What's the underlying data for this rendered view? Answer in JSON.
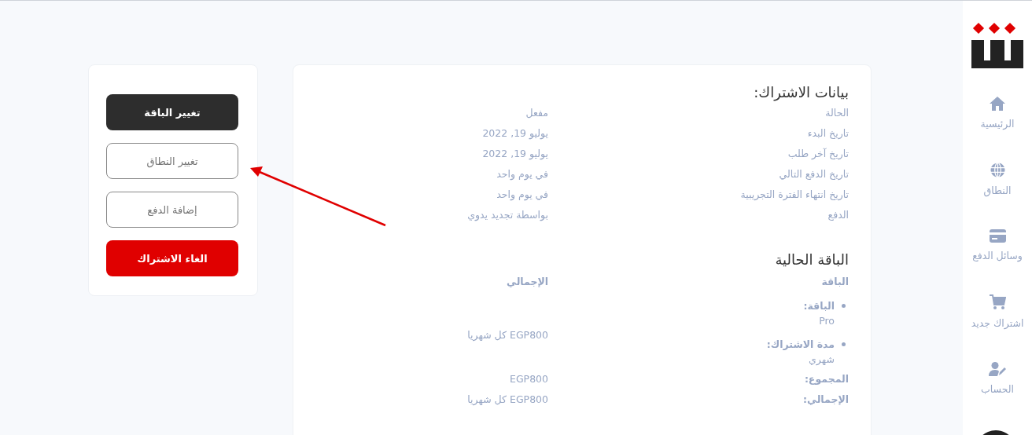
{
  "sidebar": {
    "items": [
      {
        "kind": "home",
        "label": "الرئيسية"
      },
      {
        "kind": "globe",
        "label": "النطاق"
      },
      {
        "kind": "card",
        "label": "وسائل الدفع"
      },
      {
        "kind": "cart",
        "label": "اشتراك جديد"
      },
      {
        "kind": "account",
        "label": "الحساب"
      }
    ]
  },
  "subscription_details": {
    "title": "بيانات الاشتراك:",
    "rows": [
      {
        "label": "الحالة",
        "value": "مفعل"
      },
      {
        "label": "تاريخ البدء",
        "value": "يوليو 19, 2022"
      },
      {
        "label": "تاريخ آخر طلب",
        "value": "يوليو 19, 2022"
      },
      {
        "label": "تاريخ الدفع التالي",
        "value": "في يوم واحد"
      },
      {
        "label": "تاريخ انتهاء الفترة التجريبية",
        "value": "في يوم واحد"
      },
      {
        "label": "الدفع",
        "value": "بواسطة تجديد يدوي"
      }
    ]
  },
  "current_plan": {
    "title": "الباقة الحالية",
    "header": {
      "column_1": "الباقة",
      "column_2": "الإجمالي"
    },
    "items": [
      {
        "label": "الباقة:",
        "value": "Pro"
      },
      {
        "label": "مدة الاشتراك:",
        "value": "شهري"
      }
    ],
    "item_total": "EGP800 كل شهريا",
    "summary": [
      {
        "label": "المجموع:",
        "value": "EGP800"
      },
      {
        "label": "الإجمالي:",
        "value": "EGP800 كل شهريا"
      }
    ]
  },
  "actions": [
    {
      "kind": "primary",
      "label": "تغيير الباقة"
    },
    {
      "kind": "outline",
      "label": "تغيير النطاق"
    },
    {
      "kind": "outline",
      "label": "إضافة الدفع"
    },
    {
      "kind": "danger",
      "label": "الغاء الاشتراك"
    }
  ]
}
